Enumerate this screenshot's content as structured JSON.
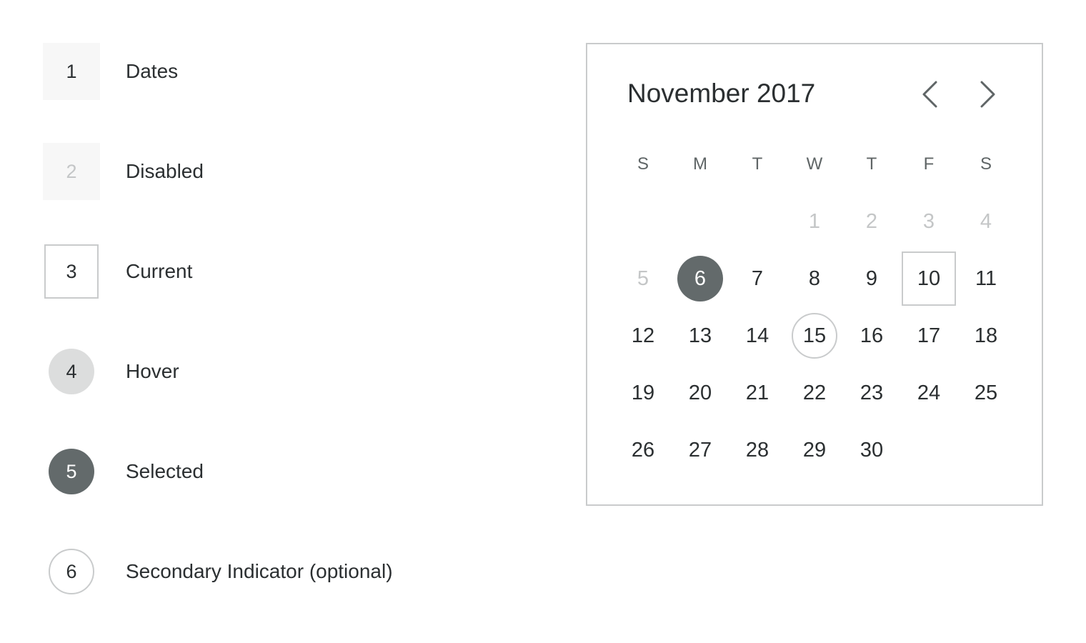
{
  "legend": {
    "items": [
      {
        "number": "1",
        "label": "Dates",
        "style": "dates"
      },
      {
        "number": "2",
        "label": "Disabled",
        "style": "disabled"
      },
      {
        "number": "3",
        "label": "Current",
        "style": "current"
      },
      {
        "number": "4",
        "label": "Hover",
        "style": "hover"
      },
      {
        "number": "5",
        "label": "Selected",
        "style": "selected"
      },
      {
        "number": "6",
        "label": "Secondary Indicator (optional)",
        "style": "secondary"
      }
    ]
  },
  "calendar": {
    "title": "November 2017",
    "prev_icon": "chevron-left-icon",
    "next_icon": "chevron-right-icon",
    "weekdays": [
      "S",
      "M",
      "T",
      "W",
      "T",
      "F",
      "S"
    ],
    "weeks": [
      [
        null,
        null,
        null,
        "1",
        "2",
        "3",
        "4"
      ],
      [
        "5",
        "6",
        "7",
        "8",
        "9",
        "10",
        "11"
      ],
      [
        "12",
        "13",
        "14",
        "15",
        "16",
        "17",
        "18"
      ],
      [
        "19",
        "20",
        "21",
        "22",
        "23",
        "24",
        "25"
      ],
      [
        "26",
        "27",
        "28",
        "29",
        "30",
        null,
        null
      ]
    ],
    "disabled_days": [
      "1",
      "2",
      "3",
      "4",
      "5"
    ],
    "selected_day": "6",
    "current_day": "10",
    "secondary_day": "15"
  },
  "colors": {
    "text": "#2b2f31",
    "disabled_text": "#c4c6c7",
    "selected_fill": "#636a6b",
    "hover_fill": "#dcdddd",
    "date_fill": "#f7f7f7",
    "border": "#c9cbcc"
  }
}
